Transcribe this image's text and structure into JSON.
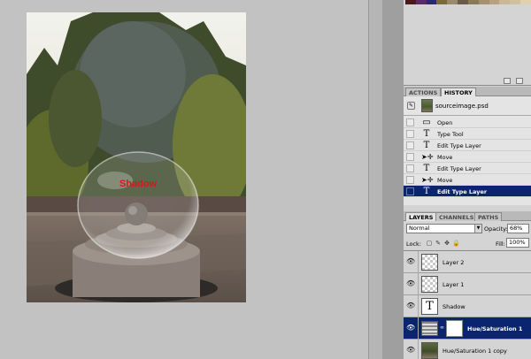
{
  "canvas": {
    "overlay_text": "Shadow"
  },
  "swatches": {
    "colors": [
      "#4a1a1a",
      "#5a2a6a",
      "#2a2a6a",
      "#7a6a3a",
      "#9a8a6a",
      "#6a5a4a",
      "#8a7a5a",
      "#a49070",
      "#b8a080",
      "#c8b898",
      "#d0c0a0",
      "#e0d0b0"
    ]
  },
  "history_tabs": [
    {
      "label": "ACTIONS",
      "active": false
    },
    {
      "label": "HISTORY",
      "active": true
    }
  ],
  "history": {
    "snapshot": {
      "label": "sourceimage.psd"
    },
    "steps": [
      {
        "label": "Open",
        "icon": "document-icon"
      },
      {
        "label": "Type Tool",
        "icon": "type-tool-icon"
      },
      {
        "label": "Edit Type Layer",
        "icon": "type-tool-icon"
      },
      {
        "label": "Move",
        "icon": "move-tool-icon"
      },
      {
        "label": "Edit Type Layer",
        "icon": "type-tool-icon"
      },
      {
        "label": "Move",
        "icon": "move-tool-icon"
      },
      {
        "label": "Edit Type Layer",
        "icon": "type-tool-icon",
        "active": true
      }
    ]
  },
  "layers_tabs": [
    {
      "label": "LAYERS",
      "active": true
    },
    {
      "label": "CHANNELS",
      "active": false
    },
    {
      "label": "PATHS",
      "active": false
    }
  ],
  "layers": {
    "blend_mode": "Normal",
    "opacity_label": "Opacity:",
    "opacity_value": "68%",
    "lock_label": "Lock:",
    "fill_label": "Fill:",
    "fill_value": "100%",
    "items": [
      {
        "name": "Layer 2",
        "thumb": "transparent"
      },
      {
        "name": "Layer 1",
        "thumb": "transparent"
      },
      {
        "name": "Shadow",
        "thumb": "type"
      },
      {
        "name": "Hue/Saturation 1",
        "thumb": "adjustment",
        "selected": true
      },
      {
        "name": "Hue/Saturation 1 copy",
        "thumb": "image"
      }
    ]
  }
}
